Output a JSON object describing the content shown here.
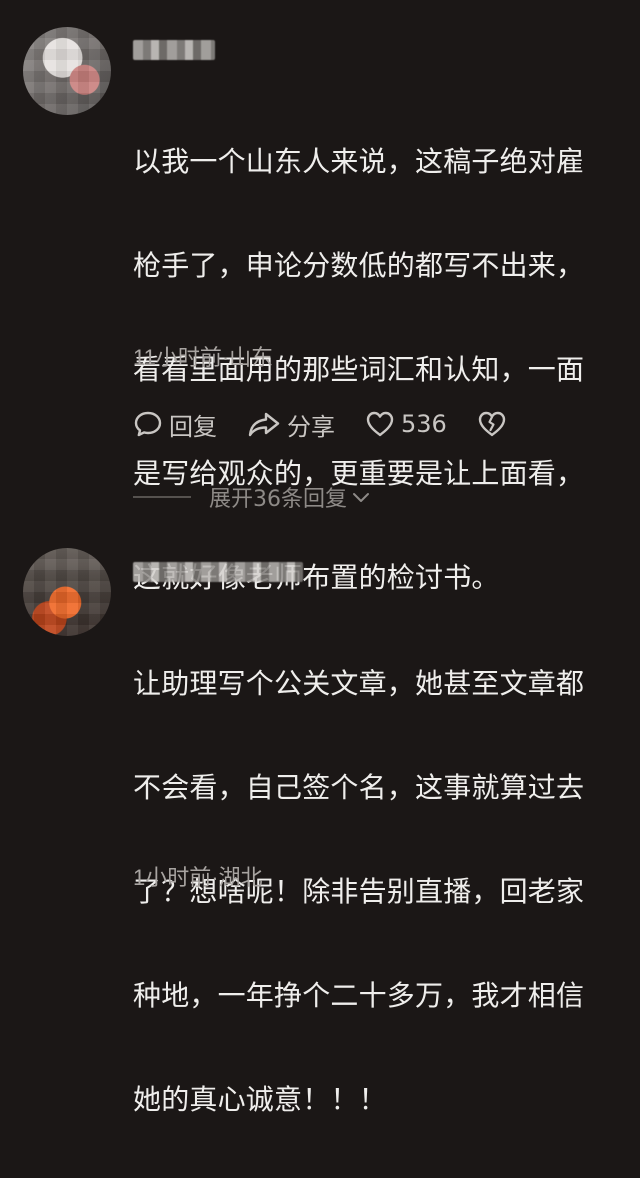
{
  "comments": [
    {
      "text_lines": [
        "以我一个山东人来说，这稿子绝对雇",
        "枪手了，申论分数低的都写不出来，",
        "看看里面用的那些词汇和认知，一面",
        "是写给观众的，更重要是让上面看，",
        "这就好像老师布置的检讨书。"
      ],
      "meta": "11小时前·山东",
      "reply_label": "回复",
      "share_label": "分享",
      "like_count": "536",
      "expand_label": "展开36条回复"
    },
    {
      "text_lines": [
        "让助理写个公关文章，她甚至文章都",
        "不会看，自己签个名，这事就算过去",
        "了？想啥呢！除非告别直播，回老家",
        "种地，一年挣个二十多万，我才相信",
        "她的真心诚意！！！"
      ],
      "meta": "1小时前·湖北"
    }
  ],
  "icons": {
    "reply": "comment-bubble-icon",
    "share": "share-arrow-icon",
    "like": "heart-icon",
    "dislike": "broken-heart-icon",
    "expand": "chevron-down-icon"
  },
  "colors": {
    "background": "#1b1716",
    "text": "#efeeec",
    "meta": "#a8a4a1",
    "action": "#c9c6c3",
    "expand": "#8e8a87"
  }
}
